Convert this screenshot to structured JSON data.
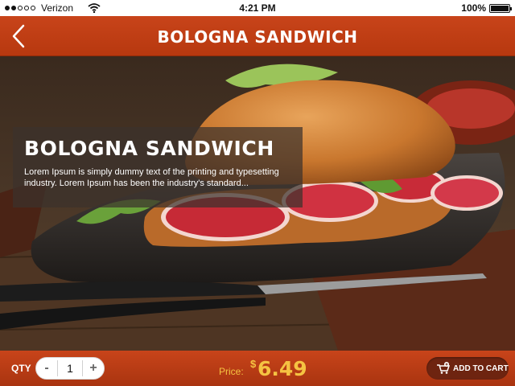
{
  "status_bar": {
    "carrier": "Verizon",
    "time": "4:21 PM",
    "battery": "100%"
  },
  "nav": {
    "title": "BOLOGNA SANDWICH",
    "back_icon": "chevron-left-icon"
  },
  "product": {
    "title": "BOLOGNA SANDWICH",
    "description": "Lorem Ipsum is simply dummy text of the printing and typesetting industry. Lorem Ipsum has been the industry's standard..."
  },
  "bottom_bar": {
    "qty_label": "QTY",
    "qty_value": "1",
    "minus_label": "-",
    "plus_label": "+",
    "price_label": "Price:",
    "currency": "$",
    "price": "6.49",
    "add_to_cart_label": "ADD TO CART",
    "cart_icon": "cart-plus-icon"
  },
  "colors": {
    "accent": "#c1401a",
    "price": "#f5c342",
    "cart_button": "#6e2410"
  }
}
